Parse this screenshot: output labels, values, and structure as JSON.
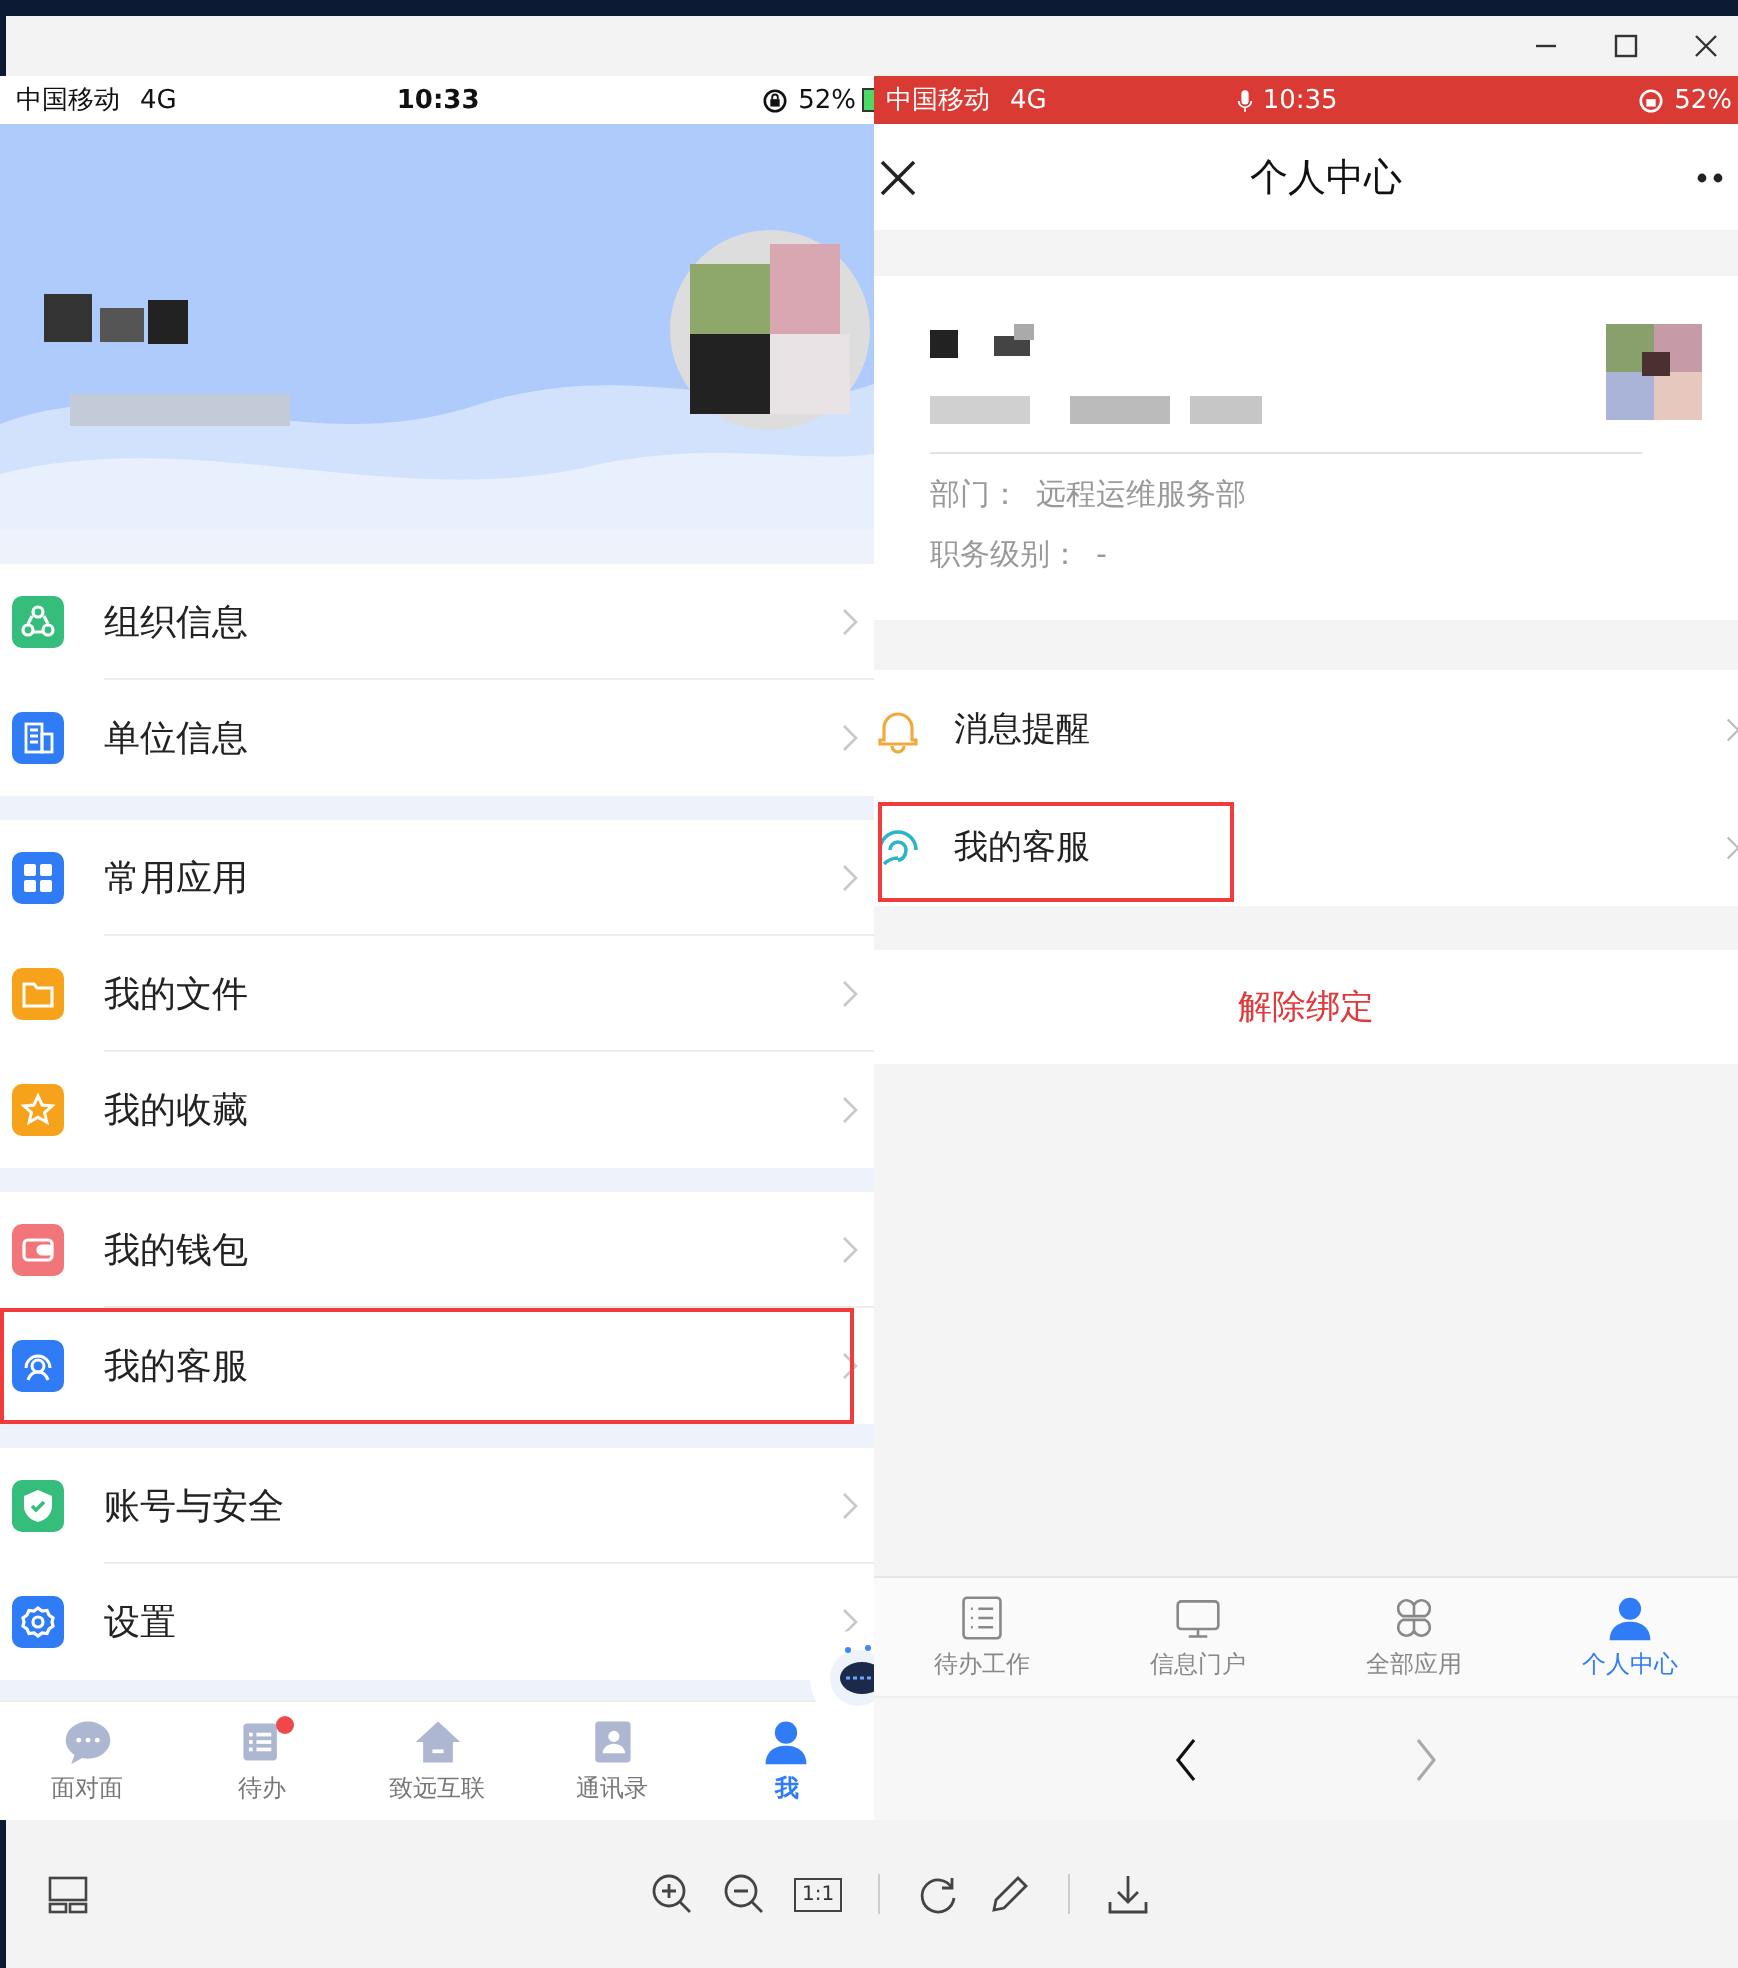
{
  "left_screen": {
    "status_bar": {
      "carrier": "中国移动",
      "network": "4G",
      "time": "10:33",
      "battery": "52%"
    },
    "menu_groups": [
      {
        "items": [
          {
            "label": "组织信息",
            "color": "#35bd7c",
            "highlighted": false
          },
          {
            "label": "单位信息",
            "color": "#2f7cf6",
            "highlighted": false
          }
        ]
      },
      {
        "items": [
          {
            "label": "常用应用",
            "color": "#2f7cf6",
            "highlighted": false
          },
          {
            "label": "我的文件",
            "color": "#f7a21b",
            "highlighted": false
          },
          {
            "label": "我的收藏",
            "color": "#f7a21b",
            "highlighted": false
          }
        ]
      },
      {
        "items": [
          {
            "label": "我的钱包",
            "color": "#f2757a",
            "highlighted": false
          },
          {
            "label": "我的客服",
            "color": "#2f7cf6",
            "highlighted": true
          }
        ]
      },
      {
        "items": [
          {
            "label": "账号与安全",
            "color": "#35bd7c",
            "highlighted": false
          },
          {
            "label": "设置",
            "color": "#2f7cf6",
            "highlighted": false
          }
        ]
      }
    ],
    "tab_bar": [
      {
        "label": "面对面",
        "selected": false,
        "badge": false
      },
      {
        "label": "待办",
        "selected": false,
        "badge": true
      },
      {
        "label": "致远互联",
        "selected": false,
        "badge": false
      },
      {
        "label": "通讯录",
        "selected": false,
        "badge": false
      },
      {
        "label": "我",
        "selected": true,
        "badge": false
      }
    ]
  },
  "right_screen": {
    "status_bar": {
      "carrier": "中国移动",
      "network": "4G",
      "time": "10:35",
      "battery": "52%"
    },
    "title": "个人中心",
    "profile_fields": [
      {
        "label": "部门：",
        "value": "远程运维服务部"
      },
      {
        "label": "职务级别：",
        "value": "-"
      }
    ],
    "menu": [
      {
        "label": "消息提醒",
        "color": "#f2a93b",
        "highlighted": false
      },
      {
        "label": "我的客服",
        "color": "#2bb5c9",
        "highlighted": true
      }
    ],
    "unbind_button": "解除绑定",
    "tab_bar": [
      {
        "label": "待办工作",
        "selected": false
      },
      {
        "label": "信息门户",
        "selected": false
      },
      {
        "label": "全部应用",
        "selected": false
      },
      {
        "label": "个人中心",
        "selected": true
      }
    ],
    "nav": {
      "back_enabled": true,
      "forward_enabled": false
    }
  },
  "viewer_toolbar": {
    "actual_size": "1:1"
  }
}
